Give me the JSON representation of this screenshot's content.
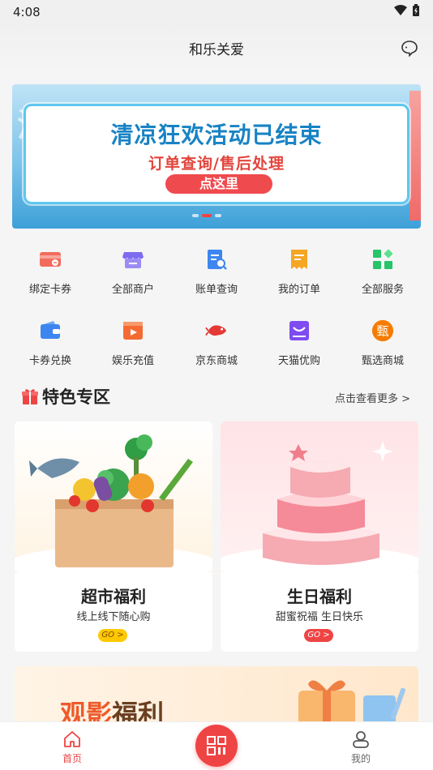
{
  "status_bar": {
    "time": "4:08"
  },
  "header": {
    "title": "和乐关爱"
  },
  "banner": {
    "deco_text": "清",
    "title": "清凉狂欢活动已结束",
    "subtitle": "订单查询/售后处理",
    "button_label": "点这里"
  },
  "services": [
    {
      "label": "绑定卡券",
      "icon": "card-bind-icon",
      "color": "#ef5350"
    },
    {
      "label": "全部商户",
      "icon": "store-icon",
      "color": "#7e6cf0"
    },
    {
      "label": "账单查询",
      "icon": "bill-search-icon",
      "color": "#3d86f0"
    },
    {
      "label": "我的订单",
      "icon": "order-icon",
      "color": "#f5a623"
    },
    {
      "label": "全部服务",
      "icon": "all-services-icon",
      "color": "#2ecc71"
    },
    {
      "label": "卡券兑换",
      "icon": "wallet-icon",
      "color": "#3d86f0"
    },
    {
      "label": "娱乐充值",
      "icon": "video-icon",
      "color": "#f56a32"
    },
    {
      "label": "京东商城",
      "icon": "jd-icon",
      "color": "#e53935"
    },
    {
      "label": "天猫优购",
      "icon": "tmall-icon",
      "color": "#7e4cf0"
    },
    {
      "label": "甄选商城",
      "icon": "select-mall-icon",
      "color": "#f57c00"
    }
  ],
  "section": {
    "title": "特色专区",
    "more": "点击查看更多 >"
  },
  "features": [
    {
      "title": "超市福利",
      "subtitle": "线上线下随心购",
      "go": "GO >",
      "go_color": "#ffc800"
    },
    {
      "title": "生日福利",
      "subtitle": "甜蜜祝福 生日快乐",
      "go": "GO >",
      "go_color": "#ef4444"
    }
  ],
  "movie": {
    "title_a": "观影",
    "title_b": "福利"
  },
  "tabbar": {
    "home": "首页",
    "mine": "我的"
  }
}
